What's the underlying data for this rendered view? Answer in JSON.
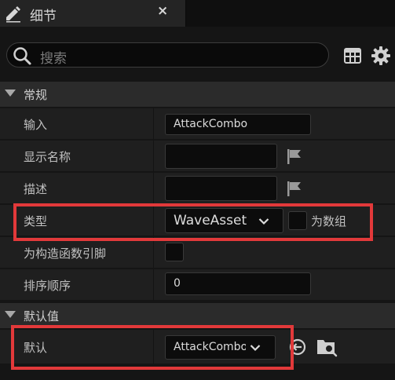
{
  "tab": {
    "title": "细节",
    "close": "×"
  },
  "search": {
    "placeholder": "搜索"
  },
  "sections": {
    "general": "常规",
    "default_values": "默认值"
  },
  "rows": {
    "input": {
      "label": "输入",
      "value": "AttackCombo"
    },
    "display_name": {
      "label": "显示名称",
      "value": ""
    },
    "description": {
      "label": "描述",
      "value": ""
    },
    "type": {
      "label": "类型",
      "value": "WaveAsset",
      "array_label": "为数组"
    },
    "constructor_pin": {
      "label": "为构造函数引脚"
    },
    "sort_order": {
      "label": "排序顺序",
      "value": "0"
    },
    "default": {
      "label": "默认",
      "value": "AttackCombo"
    }
  },
  "icons": {
    "tab": "pencil-icon",
    "search": "search-icon",
    "grid": "table-grid-icon",
    "settings": "gear-icon",
    "flag": "flag-icon",
    "chevron": "chevron-down-icon",
    "use_selected": "arrow-left-circle-icon",
    "browse": "folder-search-icon"
  },
  "colors": {
    "highlight": "#e2393a",
    "background": "#151515",
    "row": "#1f1f1f",
    "section": "#2b2b2b"
  }
}
